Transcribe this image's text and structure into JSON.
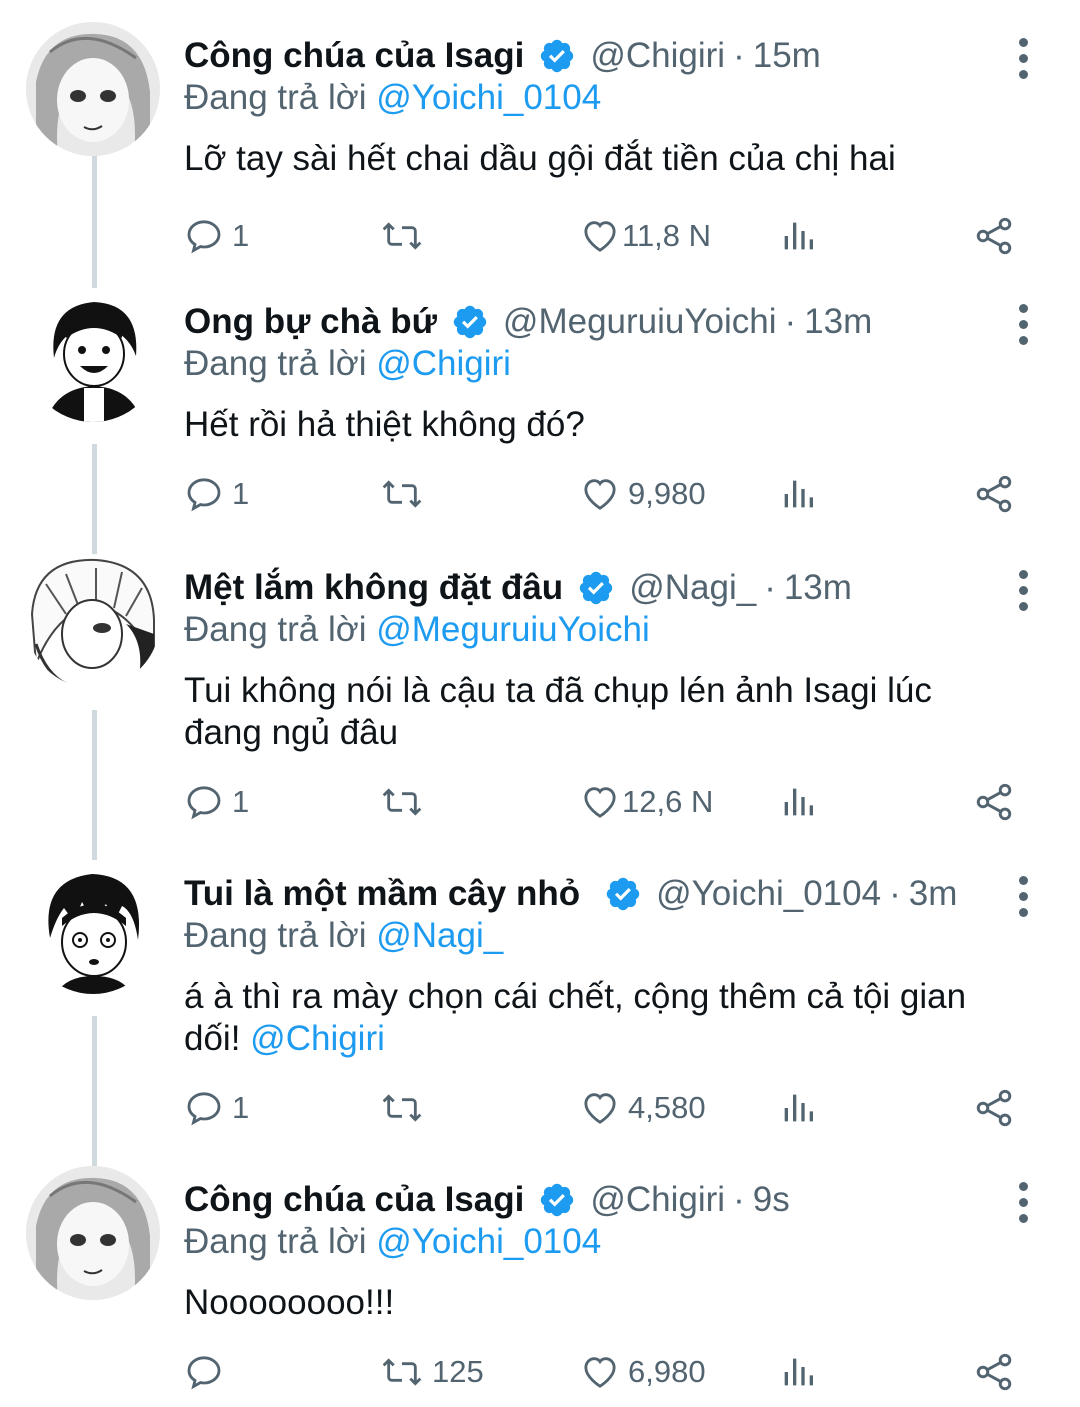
{
  "reply_prefix": "Đang trả lời",
  "tweets": [
    {
      "name": "Công chúa của Isagi",
      "handle": "@Chigiri",
      "time": "15m",
      "replying_to": "@Yoichi_0104",
      "text": "Lỡ tay sài hết chai dầu gội đắt tiền của chị hai",
      "text_mention": "",
      "replies": "1",
      "retweets": "",
      "likes": "11,8 N",
      "avatar": "red-haired-character-avatar"
    },
    {
      "name": "Ong bự chà bứ",
      "handle": "@MeguruiuYoichi",
      "time": "13m",
      "replying_to": "@Chigiri",
      "text": "Hết rồi hả thiệt không đó?",
      "text_mention": "",
      "replies": "1",
      "retweets": "",
      "likes": "9,980",
      "avatar": "grinning-character-avatar"
    },
    {
      "name": "Mệt lắm không đặt đâu",
      "handle": "@Nagi_",
      "time": "13m",
      "replying_to": "@MeguruiuYoichi",
      "text": "Tui không nói là cậu ta đã chụp lén ảnh Isagi lúc đang ngủ đâu",
      "text_mention": "",
      "replies": "1",
      "retweets": "",
      "likes": "12,6 N",
      "avatar": "white-haired-character-avatar"
    },
    {
      "name": "Tui là một mầm cây nhỏ",
      "handle": "@Yoichi_0104",
      "time": "3m",
      "replying_to": "@Nagi_",
      "text": "á à thì ra mày chọn cái chết, cộng thêm cả tội gian dối!",
      "text_mention": "@Chigiri",
      "replies": "1",
      "retweets": "",
      "likes": "4,580",
      "avatar": "dark-haired-character-avatar"
    },
    {
      "name": "Công chúa của Isagi",
      "handle": "@Chigiri",
      "time": "9s",
      "replying_to": "@Yoichi_0104",
      "text": "Noooooooo!!!",
      "text_mention": "",
      "replies": "",
      "retweets": "125",
      "likes": "6,980",
      "avatar": "red-haired-character-avatar"
    }
  ],
  "colors": {
    "accent": "#1d9bf0",
    "secondary_text": "#536471",
    "thread_line": "#cfd9de"
  },
  "icons": [
    "more-vertical-icon",
    "verified-badge-icon",
    "reply-icon",
    "retweet-icon",
    "like-icon",
    "views-icon",
    "share-icon"
  ]
}
